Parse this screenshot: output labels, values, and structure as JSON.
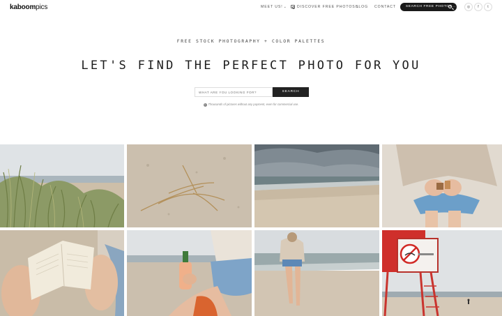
{
  "header": {
    "logo_bold": "kaboom",
    "logo_light": "pics",
    "nav": {
      "meet_us": "MEET US!",
      "discover": "DISCOVER FREE PHOTOS",
      "blog": "BLOG",
      "contact": "CONTACT"
    },
    "search_pill": "SEARCH FREE PHOTOS...",
    "social": [
      {
        "icon": "instagram-icon",
        "glyph": "◎"
      },
      {
        "icon": "facebook-icon",
        "glyph": "f"
      },
      {
        "icon": "twitter-icon",
        "glyph": "t"
      }
    ]
  },
  "hero": {
    "tagline": "FREE STOCK PHOTOGRAPHY + COLOR PALETTES",
    "headline": "LET'S FIND THE PERFECT PHOTO FOR YOU",
    "search_placeholder": "WHAT ARE YOU LOOKING FOR?",
    "search_button": "SEARCH",
    "note": "Thousands of pictures without any payment, even for commercial use."
  },
  "photos": [
    {
      "subject": "dune grass by the sea"
    },
    {
      "subject": "dry grass on sand"
    },
    {
      "subject": "stormy beach shoreline"
    },
    {
      "subject": "hands holding wooden toys"
    },
    {
      "subject": "reading a book on the beach"
    },
    {
      "subject": "woman holding a bottle of rose"
    },
    {
      "subject": "woman walking toward the sea"
    },
    {
      "subject": "lifeguard tower no swimming sign"
    }
  ],
  "colors": {
    "dark": "#1a1a1a",
    "muted_text": "#888888"
  }
}
